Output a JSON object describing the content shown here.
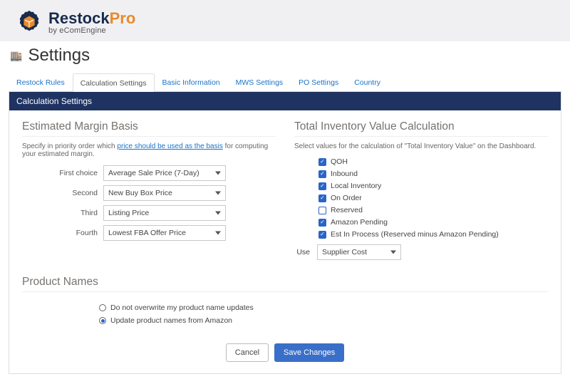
{
  "brand": {
    "name1": "Restock",
    "name2": "Pro",
    "byline": "by eComEngine"
  },
  "page_title": "Settings",
  "tabs": [
    "Restock Rules",
    "Calculation Settings",
    "Basic Information",
    "MWS Settings",
    "PO Settings",
    "Country"
  ],
  "active_tab": 1,
  "panel_title": "Calculation Settings",
  "margin": {
    "heading": "Estimated Margin Basis",
    "help_pre": "Specify in priority order which ",
    "help_link": "price should be used as the basis",
    "help_post": " for computing your estimated margin.",
    "rows": [
      {
        "label": "First choice",
        "value": "Average Sale Price (7-Day)"
      },
      {
        "label": "Second",
        "value": "New Buy Box Price"
      },
      {
        "label": "Third",
        "value": "Listing Price"
      },
      {
        "label": "Fourth",
        "value": "Lowest FBA Offer Price"
      }
    ]
  },
  "inventory": {
    "heading": "Total Inventory Value Calculation",
    "help": "Select values for the calculation of \"Total Inventory Value\" on the Dashboard.",
    "checks": [
      {
        "label": "QOH",
        "checked": true
      },
      {
        "label": "Inbound",
        "checked": true
      },
      {
        "label": "Local Inventory",
        "checked": true
      },
      {
        "label": "On Order",
        "checked": true
      },
      {
        "label": "Reserved",
        "checked": false
      },
      {
        "label": "Amazon Pending",
        "checked": true
      },
      {
        "label": "Est In Process (Reserved minus Amazon Pending)",
        "checked": true
      }
    ],
    "use_label": "Use",
    "use_value": "Supplier Cost"
  },
  "product": {
    "heading": "Product Names",
    "radios": [
      {
        "label": "Do not overwrite my product name updates",
        "selected": false
      },
      {
        "label": "Update product names from Amazon",
        "selected": true
      }
    ]
  },
  "buttons": {
    "cancel": "Cancel",
    "save": "Save Changes"
  }
}
